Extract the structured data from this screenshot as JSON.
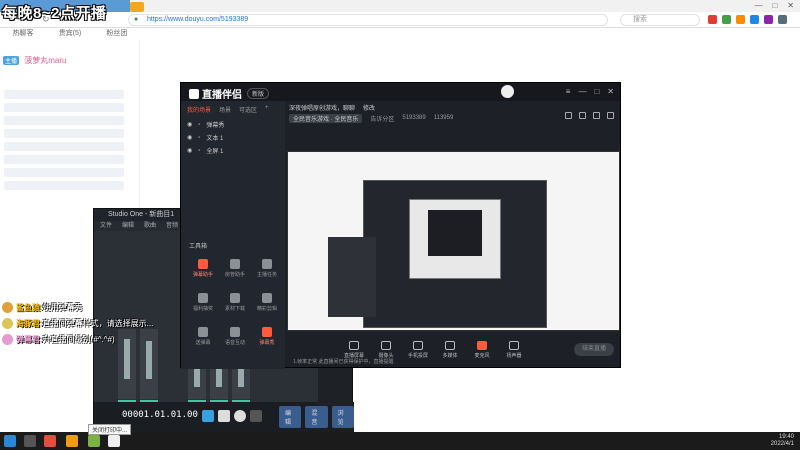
{
  "overlay": {
    "title": "每晚8~2点开播"
  },
  "browser": {
    "url": "https://www.douyu.com/5193389",
    "search_placeholder": "搜索",
    "back": "←",
    "forward": "→",
    "reload": "↻",
    "minimize": "—",
    "maximize": "□",
    "close": "✕"
  },
  "page": {
    "subtabs": [
      "热聊客",
      "贵宾(5)",
      "粉丝团"
    ],
    "user_badge": "主播",
    "user_name": "菠萝丸maru"
  },
  "chat": [
    {
      "name": "鲨鱼猿:",
      "text": "使用弹幕秀",
      "color": "#e0a13a"
    },
    {
      "name": "海豚君:",
      "text": "直播间弹幕样式，请选择展示...",
      "color": "#d9c65a"
    },
    {
      "name": "弹幕君:",
      "text": "升直播间级别(#^.^#)",
      "color": "#e89bd0"
    }
  ],
  "studio": {
    "title": "Studio One - 新曲目1",
    "menu": [
      "文件",
      "编辑",
      "歌曲",
      "音频",
      "视图",
      "帮助"
    ],
    "time": "00001.01.01.00",
    "tabs": [
      "编辑",
      "混音",
      "浏览"
    ]
  },
  "live": {
    "logo": "直播伴侣",
    "version": "新版",
    "side_tabs": [
      "我的场景",
      "场景",
      "可选区"
    ],
    "scenes": [
      "弹幕秀",
      "文本 1",
      "全屏 1"
    ],
    "tools_label": "工具箱",
    "tools": [
      {
        "label": "弹幕助手",
        "hot": true
      },
      {
        "label": "房管助手",
        "hot": false
      },
      {
        "label": "主播任务",
        "hot": false
      },
      {
        "label": "福利抽奖",
        "hot": false
      },
      {
        "label": "素材下载",
        "hot": false
      },
      {
        "label": "精彩剪辑",
        "hot": false
      },
      {
        "label": "送弹幕",
        "hot": false
      },
      {
        "label": "语音互动",
        "hot": false
      },
      {
        "label": "弹幕秀",
        "hot": true
      }
    ],
    "top_line": [
      "深夜弹唱原创游戏，聊聊",
      "修改"
    ],
    "top_line2": [
      "全民音乐游戏 · 全民音乐",
      "告诉分区",
      "5193389",
      "113959"
    ],
    "bottom_items": [
      {
        "label": "直播屏幕",
        "mic": false
      },
      {
        "label": "摄像头",
        "mic": false
      },
      {
        "label": "手机投屏",
        "mic": false
      },
      {
        "label": "多媒体",
        "mic": false
      },
      {
        "label": "麦克风",
        "mic": true
      },
      {
        "label": "扬声器",
        "mic": false
      }
    ],
    "start_label": "结束直播",
    "status": "1.帧率正常    此直播间已获得保护中，直播提醒"
  },
  "taskbar": {
    "time": "19:40",
    "date": "2022/4/1",
    "tooltip": "关闭打印中..."
  }
}
